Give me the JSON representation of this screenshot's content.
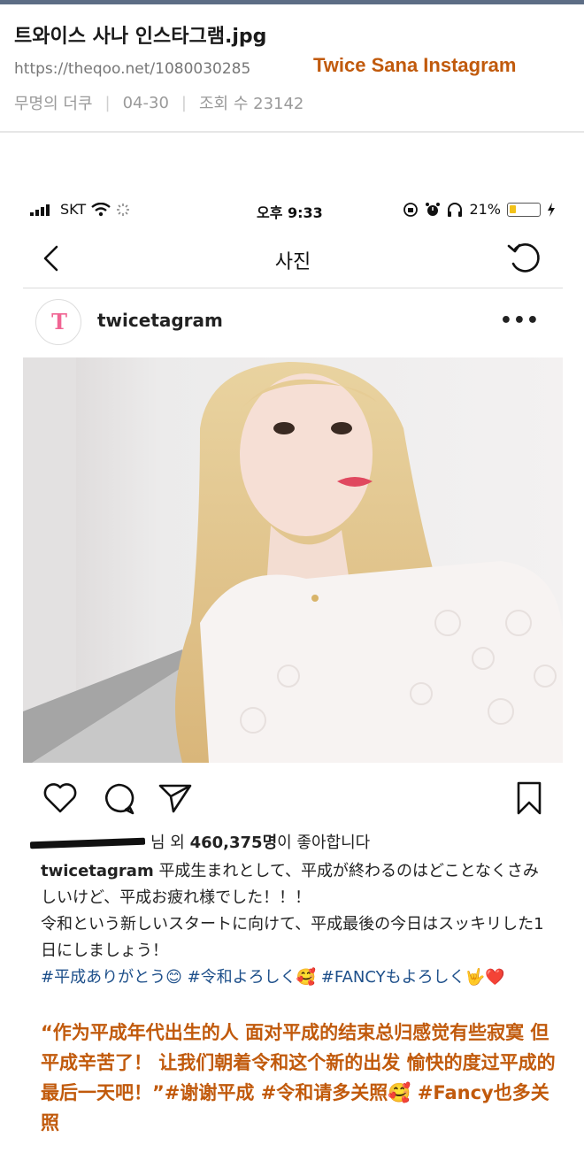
{
  "post": {
    "title": "트와이스 사나 인스타그램.jpg",
    "url": "https://theqoo.net/1080030285",
    "annotation": "Twice Sana Instagram",
    "author": "무명의 더쿠",
    "date": "04-30",
    "views": "조회 수 23142"
  },
  "phone": {
    "status": {
      "carrier": "SKT",
      "time": "오후 9:33",
      "battery": "21%",
      "battery_level": 0.21
    },
    "nav_title": "사진",
    "account": {
      "avatar_text": "T",
      "username": "twicetagram"
    },
    "likes": {
      "suffix_prefix": "님 외 ",
      "count": "460,375명",
      "suffix": "이 좋아합니다"
    },
    "caption": {
      "user": "twicetagram",
      "line1": "平成生まれとして、平成が終わるのはどことなくさみしいけど、平成お疲れ様でした！！！",
      "line2": "令和という新しいスタートに向けて、平成最後の今日はスッキリした1日にしましょう！",
      "tags": "#平成ありがとう😊 #令和よろしく🥰 #FANCYもよろしく🤟❤️"
    },
    "translation": "“作为平成年代出生的人 面对平成的结束总归感觉有些寂寞 但平成辛苦了！ 让我们朝着令和这个新的出发 愉快的度过平成的最后一天吧！”#谢谢平成 #令和请多关照🥰 #Fancy也多关照"
  },
  "colors": {
    "accent_orange": "#c15a0c",
    "hashtag_blue": "#1d4f8a",
    "battery_yellow": "#f2c21a"
  }
}
